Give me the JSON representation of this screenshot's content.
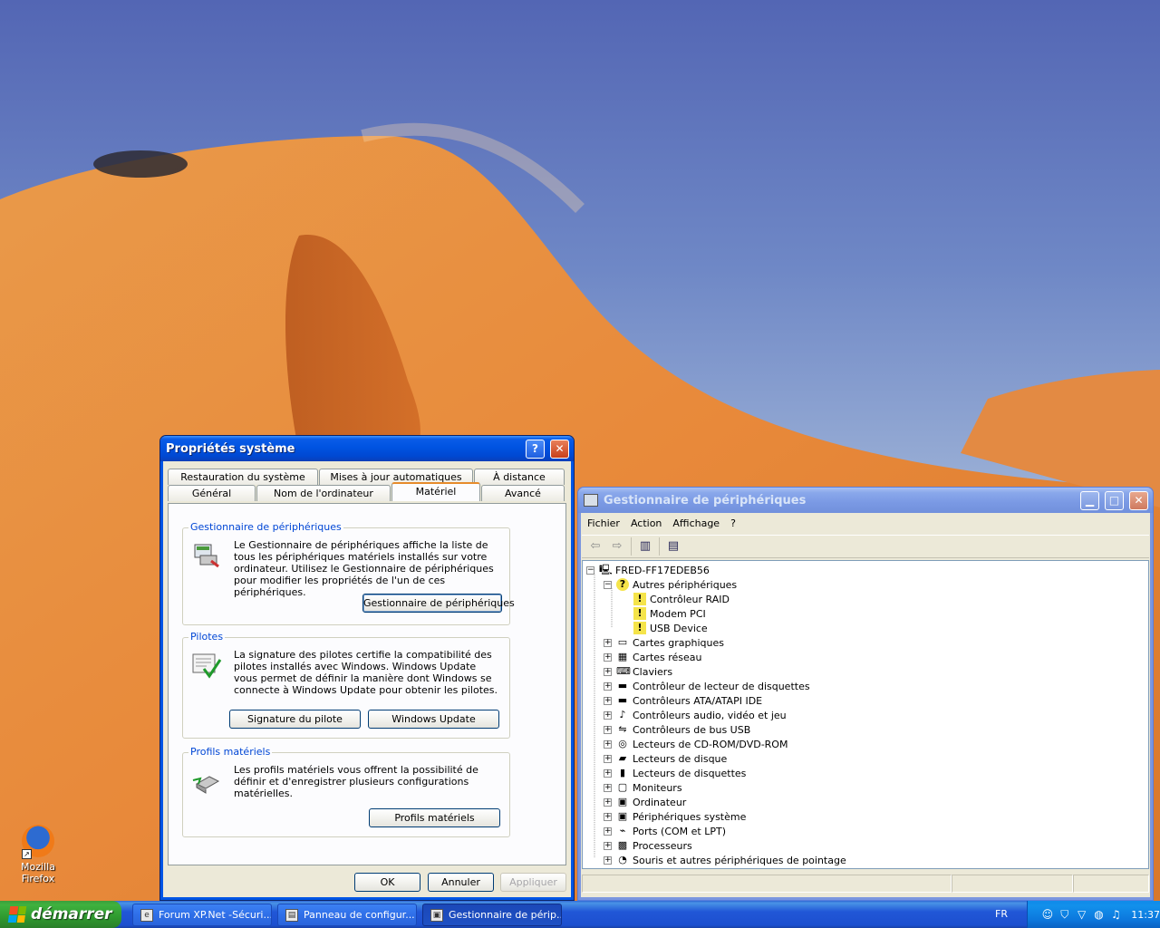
{
  "desktop": {
    "icons": [
      {
        "label": "Mozilla Firefox",
        "icon": "firefox-icon"
      }
    ]
  },
  "system_properties": {
    "title": "Propriétés système",
    "tabs_row1": [
      "Restauration du système",
      "Mises à jour automatiques",
      "À distance"
    ],
    "tabs_row2": [
      "Général",
      "Nom de l'ordinateur",
      "Matériel",
      "Avancé"
    ],
    "active_tab": "Matériel",
    "groups": [
      {
        "label": "Gestionnaire de périphériques",
        "icon": "device-manager-icon",
        "text": "Le Gestionnaire de périphériques affiche la liste de tous les périphériques matériels installés sur votre ordinateur. Utilisez le Gestionnaire de périphériques pour modifier les propriétés de l'un de ces périphériques.",
        "buttons": [
          "Gestionnaire de périphériques"
        ]
      },
      {
        "label": "Pilotes",
        "icon": "driver-signing-icon",
        "text": "La signature des pilotes certifie la compatibilité des pilotes installés avec Windows. Windows Update vous permet de définir la manière dont Windows se connecte à Windows Update pour obtenir les pilotes.",
        "buttons": [
          "Signature du pilote",
          "Windows Update"
        ]
      },
      {
        "label": "Profils matériels",
        "icon": "hardware-profiles-icon",
        "text": "Les profils matériels vous offrent la possibilité de définir et d'enregistrer plusieurs configurations matérielles.",
        "buttons": [
          "Profils matériels"
        ]
      }
    ],
    "footer_buttons": {
      "ok": "OK",
      "cancel": "Annuler",
      "apply": "Appliquer"
    }
  },
  "device_manager": {
    "title": "Gestionnaire de périphériques",
    "menu": [
      "Fichier",
      "Action",
      "Affichage",
      "?"
    ],
    "toolbar": [
      "back-icon",
      "forward-icon",
      "show-hide-tree-icon",
      "properties-icon"
    ],
    "root": "FRED-FF17EDEB56",
    "tree": [
      {
        "label": "Autres périphériques",
        "expanded": true,
        "icon": "unknown-device-icon",
        "children": [
          "Contrôleur RAID",
          "Modem PCI",
          "USB Device"
        ]
      },
      {
        "label": "Cartes graphiques",
        "icon": "display-adapter-icon"
      },
      {
        "label": "Cartes réseau",
        "icon": "network-card-icon"
      },
      {
        "label": "Claviers",
        "icon": "keyboard-icon"
      },
      {
        "label": "Contrôleur de lecteur de disquettes",
        "icon": "floppy-controller-icon"
      },
      {
        "label": "Contrôleurs ATA/ATAPI IDE",
        "icon": "ide-controller-icon"
      },
      {
        "label": "Contrôleurs audio, vidéo et jeu",
        "icon": "audio-icon"
      },
      {
        "label": "Contrôleurs de bus USB",
        "icon": "usb-icon"
      },
      {
        "label": "Lecteurs de CD-ROM/DVD-ROM",
        "icon": "cdrom-icon"
      },
      {
        "label": "Lecteurs de disque",
        "icon": "disk-drive-icon"
      },
      {
        "label": "Lecteurs de disquettes",
        "icon": "floppy-drive-icon"
      },
      {
        "label": "Moniteurs",
        "icon": "monitor-icon"
      },
      {
        "label": "Ordinateur",
        "icon": "computer-icon"
      },
      {
        "label": "Périphériques système",
        "icon": "system-device-icon"
      },
      {
        "label": "Ports (COM et LPT)",
        "icon": "port-icon"
      },
      {
        "label": "Processeurs",
        "icon": "processor-icon"
      },
      {
        "label": "Souris et autres périphériques de pointage",
        "icon": "mouse-icon"
      }
    ]
  },
  "taskbar": {
    "start_label": "démarrer",
    "tasks": [
      {
        "label": "Forum XP.Net -Sécuri...",
        "active": false
      },
      {
        "label": "Panneau de configur...",
        "active": false
      },
      {
        "label": "Gestionnaire de périp...",
        "active": true
      }
    ],
    "language": "FR",
    "tray_icons": [
      "user-icon",
      "shield-icon",
      "antivirus-icon",
      "network-icon",
      "volume-icon"
    ],
    "clock": "11:37"
  }
}
